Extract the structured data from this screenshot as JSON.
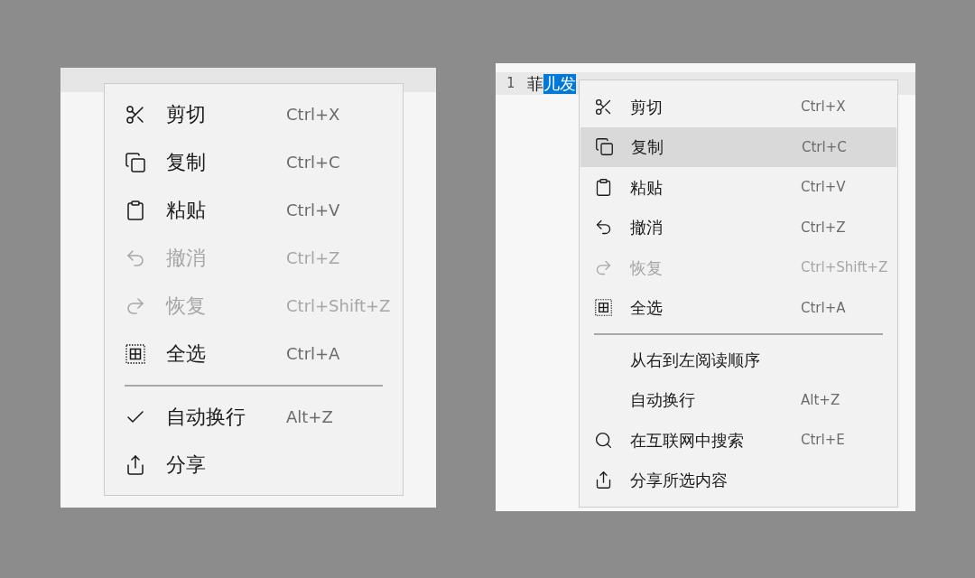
{
  "panels": [
    {
      "menu": [
        {
          "kind": "command",
          "label": "剪切",
          "shortcut": "Ctrl+X",
          "disabled": false,
          "selected": false
        },
        {
          "kind": "command",
          "label": "复制",
          "shortcut": "Ctrl+C",
          "disabled": false,
          "selected": false
        },
        {
          "kind": "command",
          "label": "粘贴",
          "shortcut": "Ctrl+V",
          "disabled": false,
          "selected": false
        },
        {
          "kind": "command",
          "label": "撤消",
          "shortcut": "Ctrl+Z",
          "disabled": true,
          "selected": false
        },
        {
          "kind": "command",
          "label": "恢复",
          "shortcut": "Ctrl+Shift+Z",
          "disabled": true,
          "selected": false
        },
        {
          "kind": "command",
          "label": "全选",
          "shortcut": "Ctrl+A",
          "disabled": false,
          "selected": false
        },
        {
          "kind": "separator"
        },
        {
          "kind": "toggle",
          "label": "自动换行",
          "shortcut": "Alt+Z",
          "checked": true,
          "disabled": false,
          "selected": false
        },
        {
          "kind": "command",
          "label": "分享",
          "disabled": false,
          "selected": false
        }
      ]
    },
    {
      "editor": {
        "line_number": "1",
        "text": "菲",
        "selected_text": "儿发"
      },
      "menu": [
        {
          "kind": "command",
          "label": "剪切",
          "shortcut": "Ctrl+X",
          "disabled": false,
          "selected": false
        },
        {
          "kind": "command",
          "label": "复制",
          "shortcut": "Ctrl+C",
          "disabled": false,
          "selected": true
        },
        {
          "kind": "command",
          "label": "粘贴",
          "shortcut": "Ctrl+V",
          "disabled": false,
          "selected": false
        },
        {
          "kind": "command",
          "label": "撤消",
          "shortcut": "Ctrl+Z",
          "disabled": false,
          "selected": false
        },
        {
          "kind": "command",
          "label": "恢复",
          "shortcut": "Ctrl+Shift+Z",
          "disabled": true,
          "selected": false
        },
        {
          "kind": "command",
          "label": "全选",
          "shortcut": "Ctrl+A",
          "disabled": false,
          "selected": false
        },
        {
          "kind": "separator"
        },
        {
          "kind": "command",
          "label": "从右到左阅读顺序",
          "disabled": false,
          "selected": false
        },
        {
          "kind": "toggle",
          "label": "自动换行",
          "shortcut": "Alt+Z",
          "checked": false,
          "disabled": false,
          "selected": false
        },
        {
          "kind": "command",
          "label": "在互联网中搜索",
          "shortcut": "Ctrl+E",
          "disabled": false,
          "selected": false
        },
        {
          "kind": "command",
          "label": "分享所选内容",
          "disabled": false,
          "selected": false
        }
      ]
    }
  ]
}
